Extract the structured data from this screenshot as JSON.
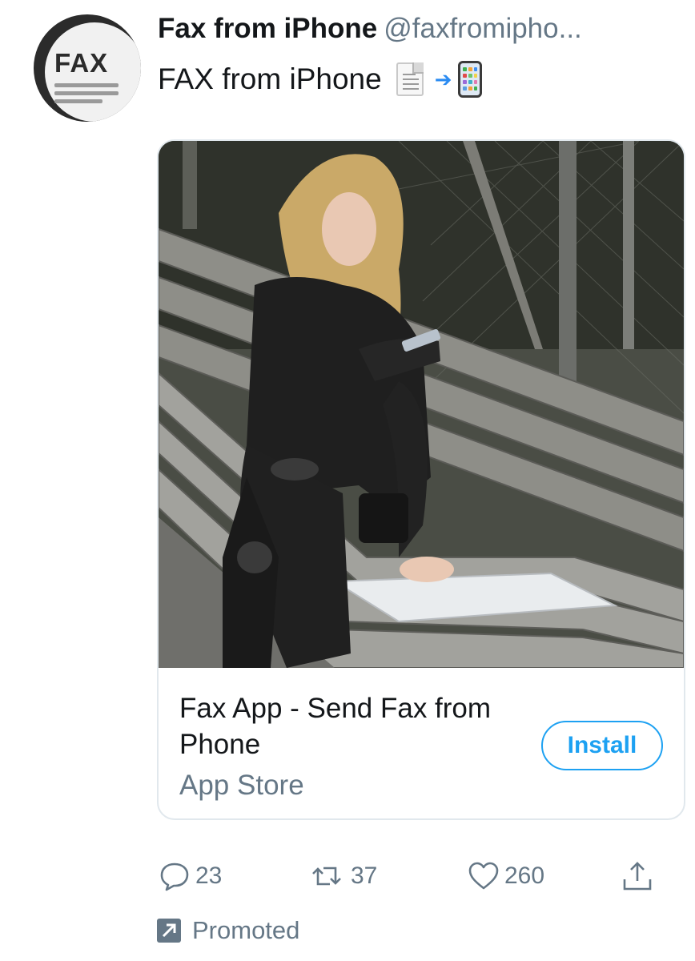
{
  "tweet": {
    "display_name": "Fax from iPhone",
    "handle": "@faxfromipho...",
    "text": "FAX from iPhone",
    "emojis": [
      "page-facing-up",
      "arrow-right",
      "mobile-phone-with-arrow"
    ]
  },
  "avatar": {
    "text": "FAX"
  },
  "card": {
    "title": "Fax App - Send Fax from Phone",
    "source": "App Store",
    "install_label": "Install",
    "image_alt": "Woman on park bench using phone over a sheet of paper"
  },
  "actions": {
    "reply_count": "23",
    "retweet_count": "37",
    "like_count": "260"
  },
  "promoted_label": "Promoted",
  "colors": {
    "accent": "#1da1f2",
    "secondary_text": "#657786",
    "border": "#e1e8ed"
  }
}
